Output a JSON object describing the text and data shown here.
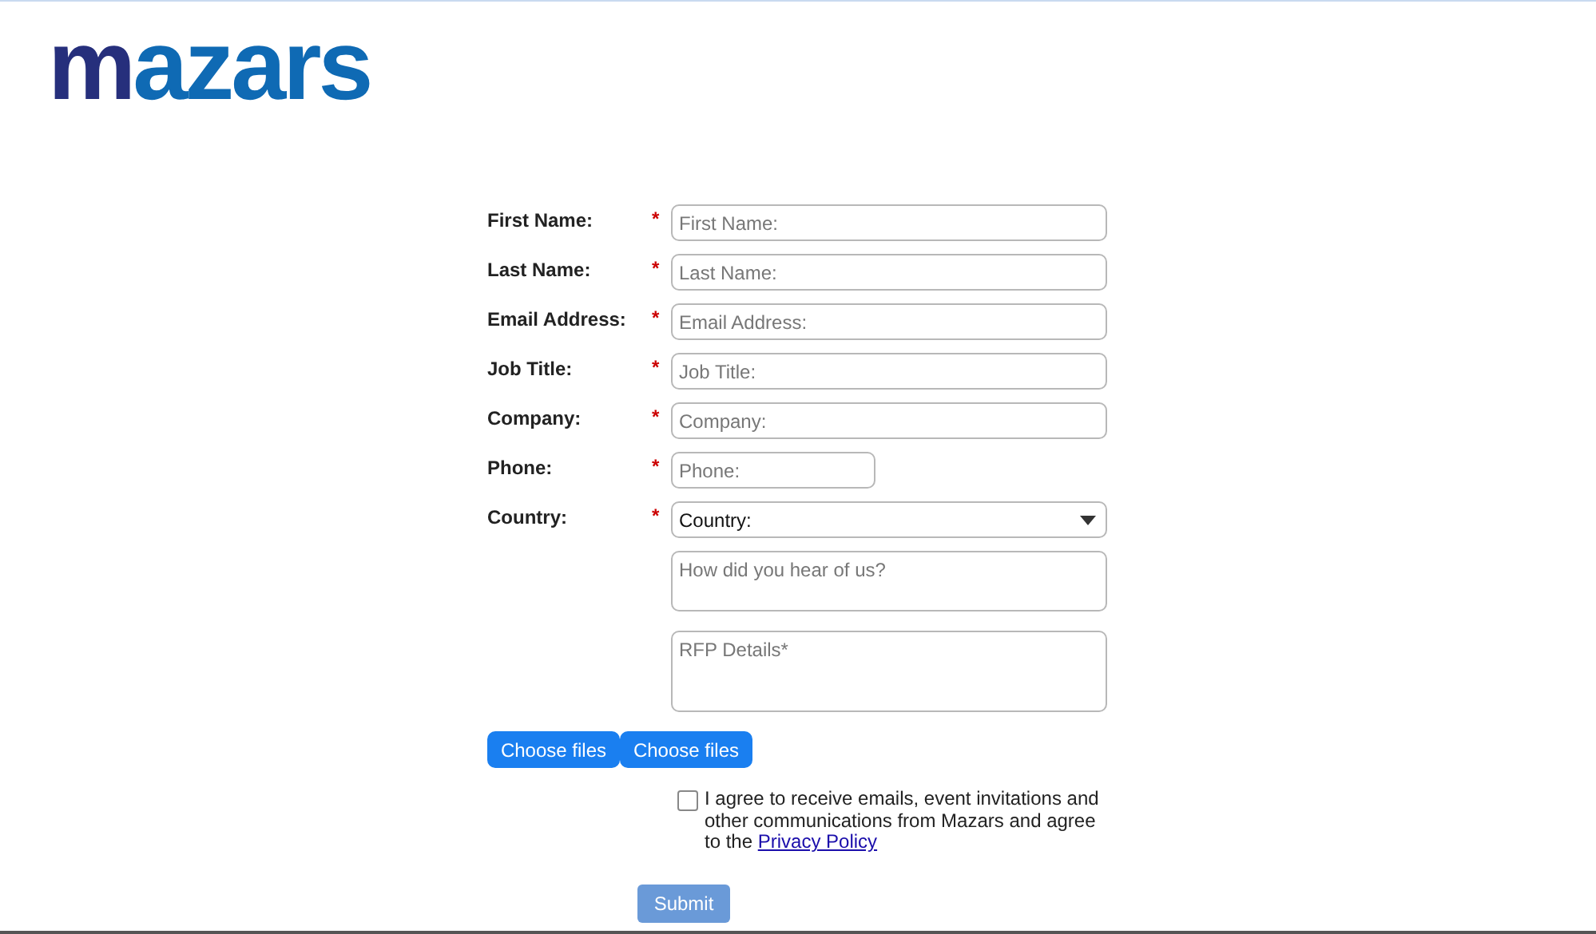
{
  "logo": {
    "parts": [
      "m",
      "azars"
    ]
  },
  "fields": [
    {
      "kind": "text",
      "label": "First Name:",
      "mark": "*",
      "placeholder": "First Name:"
    },
    {
      "kind": "text",
      "label": "Last Name:",
      "mark": "*",
      "placeholder": "Last Name:"
    },
    {
      "kind": "text",
      "label": "Email Address:",
      "mark": "*",
      "placeholder": "Email Address:"
    },
    {
      "kind": "text",
      "label": "Job Title:",
      "mark": "*",
      "placeholder": "Job Title:"
    },
    {
      "kind": "text",
      "label": "Company:",
      "mark": "*",
      "placeholder": "Company:"
    },
    {
      "kind": "short",
      "label": "Phone:",
      "mark": "*",
      "placeholder": "Phone:"
    },
    {
      "kind": "select",
      "label": "Country:",
      "mark": "*",
      "value": "Country:"
    },
    {
      "kind": "textarea",
      "placeholder": "How did you hear of us?"
    },
    {
      "kind": "tallarea",
      "placeholder": "RFP Details*"
    }
  ],
  "file_buttons": [
    "Choose files",
    "Choose files"
  ],
  "consent": {
    "checked": false,
    "text": "I agree to receive emails, event invitations and other communications from Mazars and agree to the",
    "link": "Privacy Policy"
  },
  "submit": "Submit"
}
